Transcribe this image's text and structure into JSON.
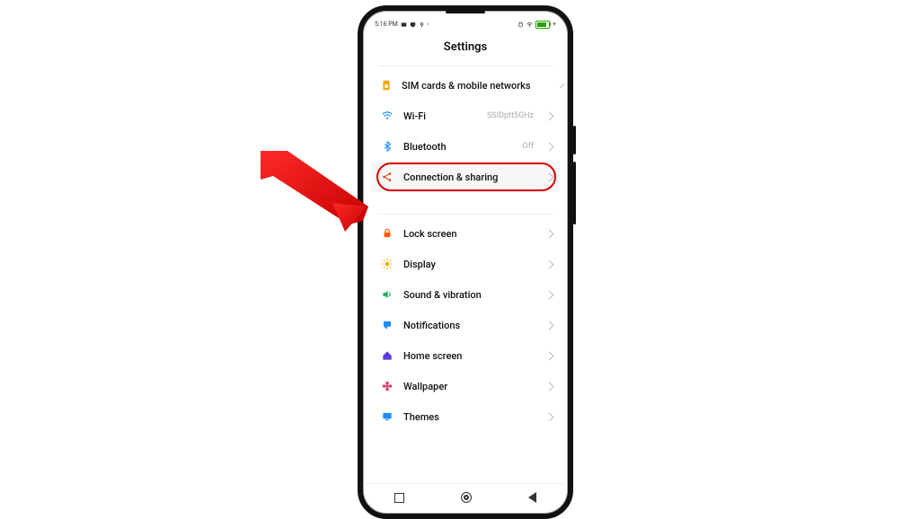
{
  "statusbar": {
    "time": "5:16 PM",
    "battery_plus": "+"
  },
  "header": {
    "title": "Settings"
  },
  "groups": [
    {
      "items": [
        {
          "id": "sim",
          "label": "SIM cards & mobile networks",
          "value": "",
          "icon": "sim-icon",
          "icon_color": "#f5a200"
        },
        {
          "id": "wifi",
          "label": "Wi-Fi",
          "value": "SSIDptt5GHz",
          "icon": "wifi-icon",
          "icon_color": "#1f8cff"
        },
        {
          "id": "bt",
          "label": "Bluetooth",
          "value": "Off",
          "icon": "bluetooth-icon",
          "icon_color": "#1f8cff"
        },
        {
          "id": "conn",
          "label": "Connection & sharing",
          "value": "",
          "icon": "share-icon",
          "icon_color": "#e43b00",
          "highlight": true
        }
      ]
    },
    {
      "items": [
        {
          "id": "lock",
          "label": "Lock screen",
          "value": "",
          "icon": "lock-icon",
          "icon_color": "#ff5a00"
        },
        {
          "id": "display",
          "label": "Display",
          "value": "",
          "icon": "sun-icon",
          "icon_color": "#ffb000"
        },
        {
          "id": "sound",
          "label": "Sound & vibration",
          "value": "",
          "icon": "speaker-icon",
          "icon_color": "#18b060"
        },
        {
          "id": "notif",
          "label": "Notifications",
          "value": "",
          "icon": "bell-icon",
          "icon_color": "#1f8cff"
        },
        {
          "id": "home",
          "label": "Home screen",
          "value": "",
          "icon": "home-icon",
          "icon_color": "#5a3bd6"
        },
        {
          "id": "wall",
          "label": "Wallpaper",
          "value": "",
          "icon": "flower-icon",
          "icon_color": "#d63b74"
        },
        {
          "id": "themes",
          "label": "Themes",
          "value": "",
          "icon": "monitor-icon",
          "icon_color": "#1f8cff"
        }
      ]
    }
  ],
  "callout": {
    "target_id": "conn"
  }
}
